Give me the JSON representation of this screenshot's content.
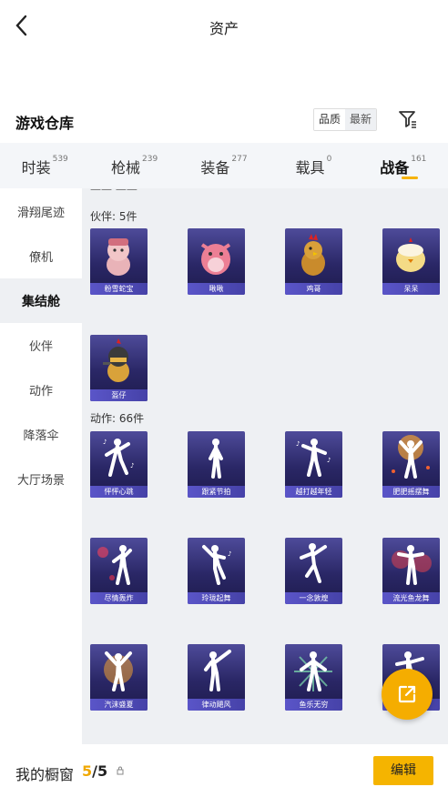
{
  "header": {
    "title": "资产"
  },
  "warehouse": {
    "title": "游戏仓库",
    "sort_quality": "品质",
    "sort_latest": "最新"
  },
  "tabs": [
    {
      "label": "时装",
      "count": "539"
    },
    {
      "label": "枪械",
      "count": "239"
    },
    {
      "label": "装备",
      "count": "277"
    },
    {
      "label": "载具",
      "count": "0"
    },
    {
      "label": "战备",
      "count": "161"
    }
  ],
  "sidebar": [
    "滑翔尾迹",
    "僚机",
    "集结舱",
    "伙伴",
    "动作",
    "降落伞",
    "大厅场景"
  ],
  "sections": {
    "partners_header": "伙伴: 5件",
    "partners": [
      "粉雪蛇宝",
      "啾啾",
      "鸡哥",
      "呆呆",
      "盔仔"
    ],
    "actions_header": "动作: 66件",
    "actions": [
      "怦怦心跳",
      "跟紧节拍",
      "越打越年轻",
      "肥肥摇摆舞",
      "尽情轰炸",
      "玲珑起舞",
      "一念敦煌",
      "流光鱼龙舞",
      "汽沫盛夏",
      "律动飓风",
      "鱼乐无穷",
      ""
    ]
  },
  "bottom": {
    "label": "我的橱窗",
    "current": "5",
    "sep": "/",
    "total": "5",
    "edit": "编辑"
  },
  "colors": {
    "accent": "#f5b400",
    "card_bg": "#2a2766",
    "card_label": "#5a55c8"
  }
}
